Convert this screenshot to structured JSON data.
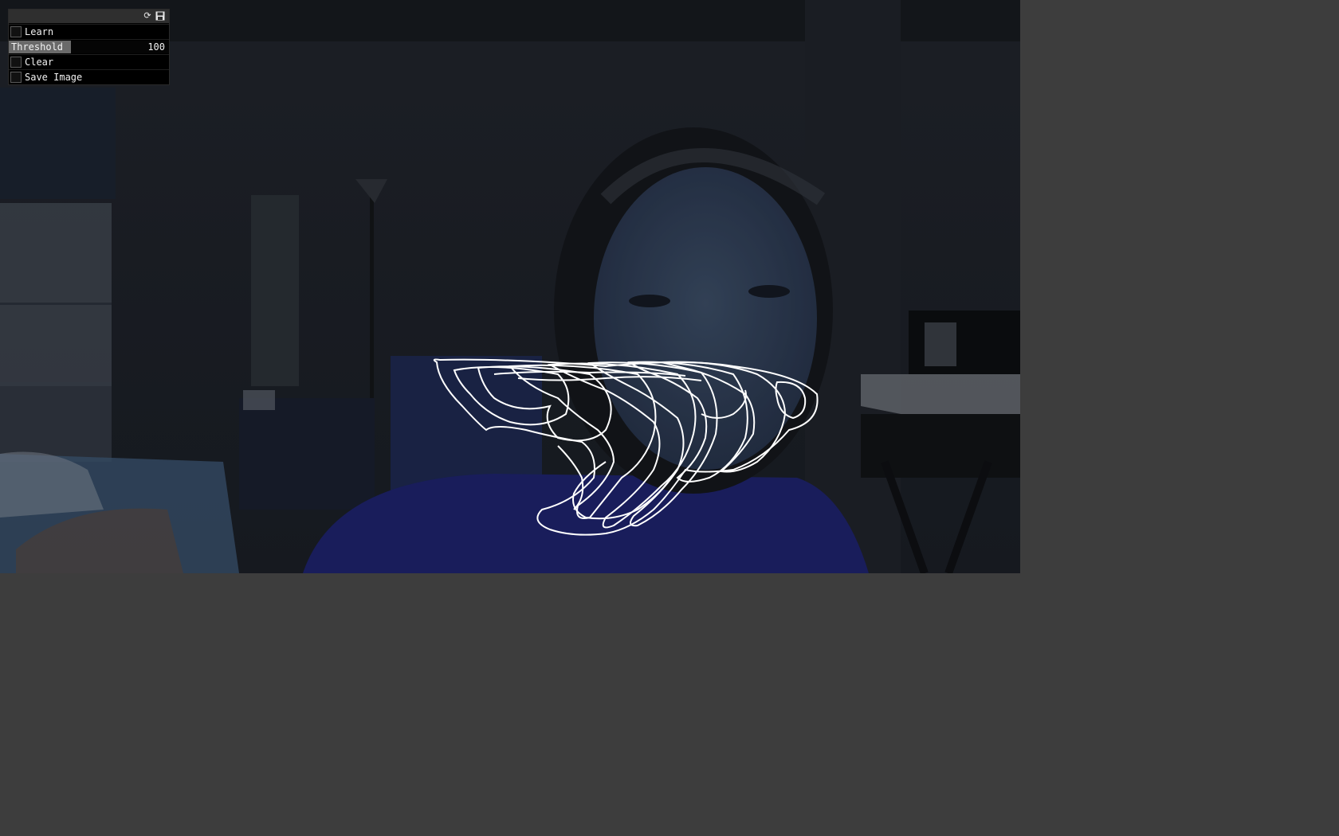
{
  "gui": {
    "header_icons": [
      "refresh-icon",
      "save-settings-icon"
    ],
    "learn": {
      "label": "Learn",
      "checked": false
    },
    "threshold": {
      "label": "Threshold",
      "value": "100",
      "min": 0,
      "max": 255,
      "fill_fraction": 0.39
    },
    "clear": {
      "label": "Clear",
      "checked": false
    },
    "save_image": {
      "label": "Save Image",
      "checked": false
    }
  },
  "colors": {
    "app_background": "#3d3d3d",
    "panel_background": "#000000",
    "panel_header": "#2f2f2f",
    "slider_fill": "#6a6a6a",
    "text": "#f2f2f2",
    "contour_stroke": "#ffffff"
  }
}
